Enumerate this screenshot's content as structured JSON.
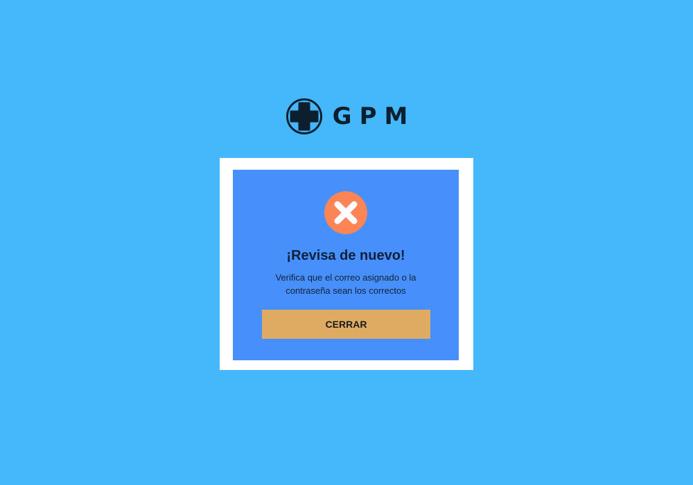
{
  "brand": {
    "name": "GPM",
    "icon": "plus-circle-icon"
  },
  "dialog": {
    "icon": "error-x-icon",
    "title": "¡Revisa de nuevo!",
    "message": "Verifica que el correo asignado o la contraseña sean los correctos",
    "close_label": "CERRAR"
  },
  "colors": {
    "background": "#45b8fb",
    "frame": "#ffffff",
    "dialog_background": "#4790fb",
    "error_icon": "#fd8455",
    "button": "#dfab62",
    "text_dark": "#11203a"
  }
}
